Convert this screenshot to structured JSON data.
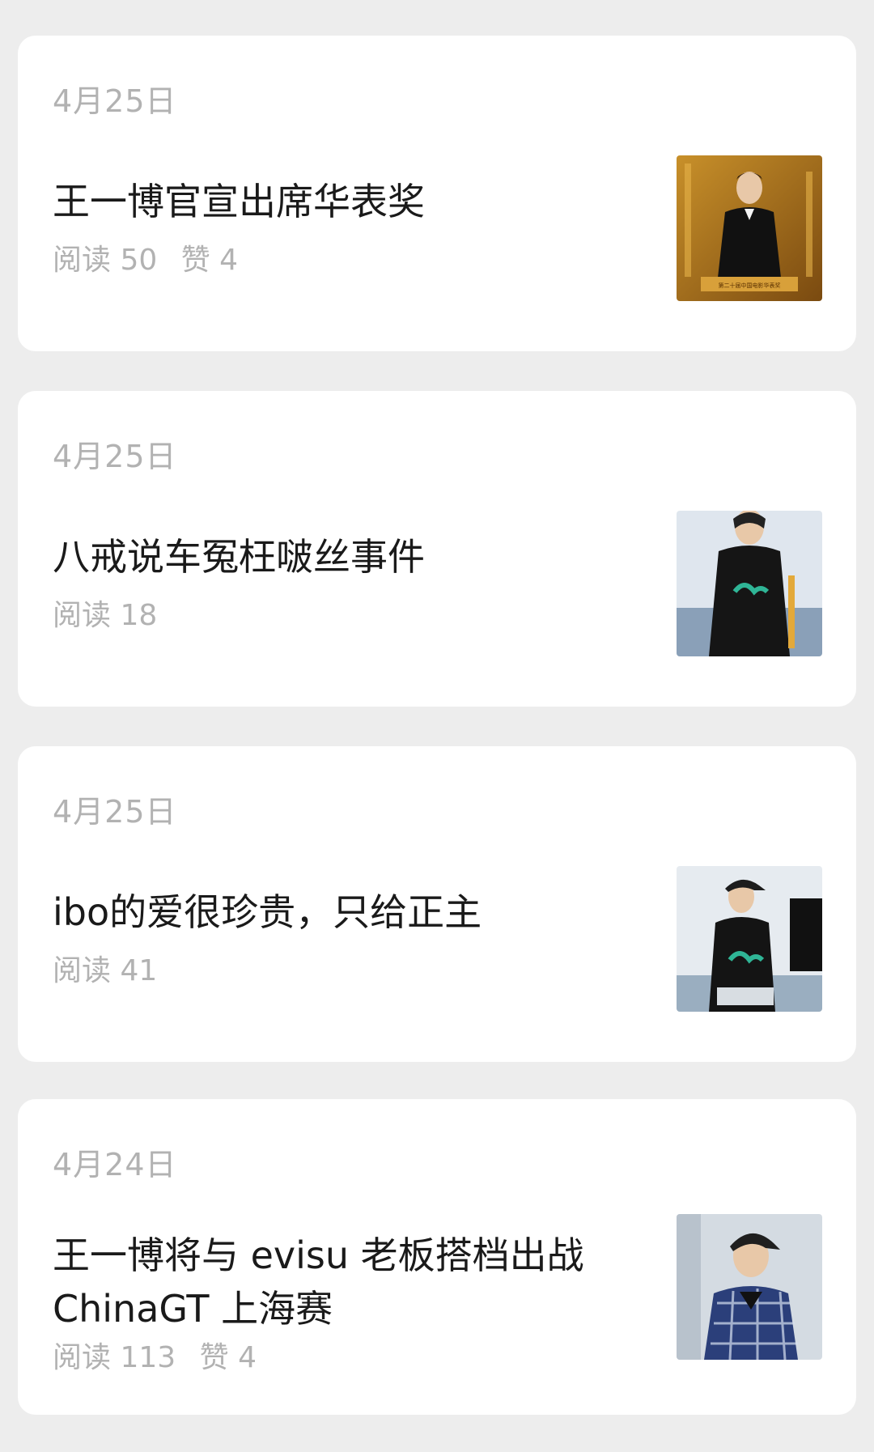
{
  "articles": [
    {
      "date": "4月25日",
      "title": "王一博官宣出席华表奖",
      "reads": "阅读 50",
      "likes": "赞 4",
      "thumbnail": "man-in-tuxedo-award-image",
      "thumbnail_caption": "第二十届中国电影华表奖"
    },
    {
      "date": "4月25日",
      "title": "八戒说车冤枉啵丝事件",
      "reads": "阅读 18",
      "likes": "",
      "thumbnail": "racer-in-black-jacket-image"
    },
    {
      "date": "4月25日",
      "title": "ibo的爱很珍贵，只给正主",
      "reads": "阅读 41",
      "likes": "",
      "thumbnail": "racer-with-cap-image"
    },
    {
      "date": "4月24日",
      "title": "王一博将与 evisu 老板搭档出战 ChinaGT 上海赛",
      "reads": "阅读 113",
      "likes": "赞 4",
      "thumbnail": "man-in-plaid-shirt-image"
    }
  ],
  "colors": {
    "background": "#ededed",
    "card": "#ffffff",
    "meta_text": "#b2b2b2",
    "title_text": "#1a1a1a"
  }
}
